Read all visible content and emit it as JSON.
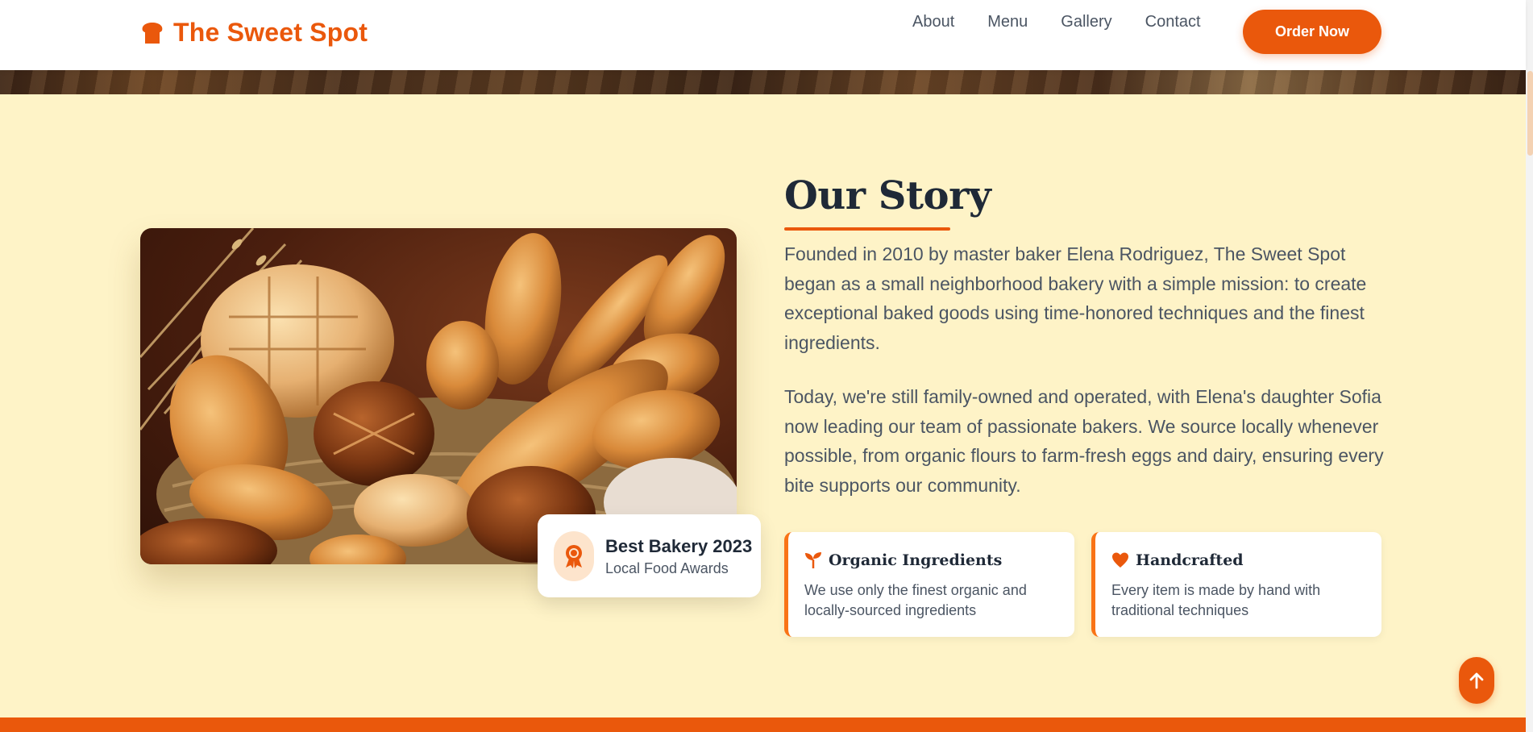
{
  "header": {
    "brand": "The Sweet Spot",
    "brand_icon": "bread-icon",
    "nav": [
      {
        "label": "About"
      },
      {
        "label": "Menu"
      },
      {
        "label": "Gallery"
      },
      {
        "label": "Contact"
      }
    ],
    "cta_label": "Order Now"
  },
  "story": {
    "title": "Our Story",
    "paragraphs": [
      "Founded in 2010 by master baker Elena Rodriguez, The Sweet Spot began as a small neighborhood bakery with a simple mission: to create exceptional baked goods using time-honored techniques and the finest ingredients.",
      "Today, we're still family-owned and operated, with Elena's daughter Sofia now leading our team of passionate bakers. We source locally whenever possible, from organic flours to farm-fresh eggs and dairy, ensuring every bite supports our community."
    ],
    "image_icon": "bread-basket-photo",
    "award": {
      "title": "Best Bakery 2023",
      "subtitle": "Local Food Awards",
      "icon": "award-ribbon-icon"
    },
    "features": [
      {
        "icon": "seedling-icon",
        "title": "Organic Ingredients",
        "description": "We use only the finest organic and locally-sourced ingredients"
      },
      {
        "icon": "heart-icon",
        "title": "Handcrafted",
        "description": "Every item is made by hand with traditional techniques"
      }
    ]
  },
  "colors": {
    "accent": "#ea580c",
    "background": "#fef3c7",
    "heading": "#1f2937",
    "body_text": "#4b5563"
  },
  "back_to_top_icon": "arrow-up-icon"
}
